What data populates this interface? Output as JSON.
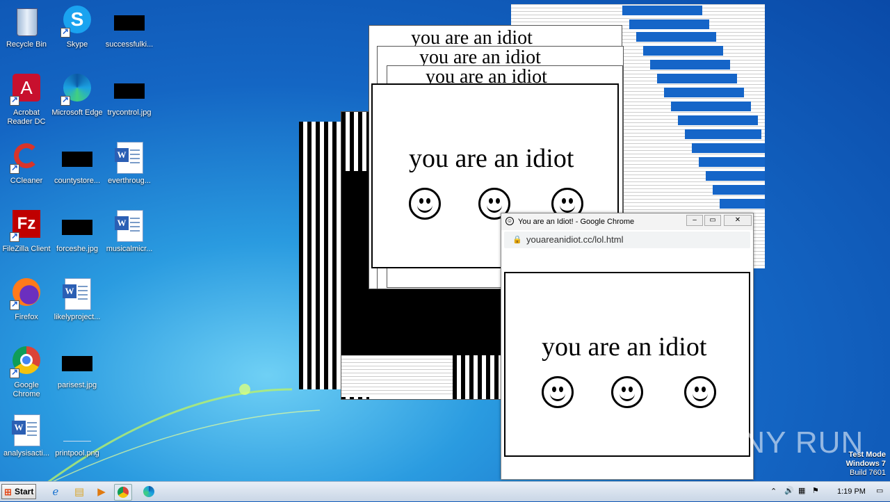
{
  "desktop": {
    "icons": [
      {
        "label": "Recycle Bin"
      },
      {
        "label": "Skype"
      },
      {
        "label": "successfulki..."
      },
      {
        "label": "Acrobat Reader DC"
      },
      {
        "label": "Microsoft Edge"
      },
      {
        "label": "trycontrol.jpg"
      },
      {
        "label": "CCleaner"
      },
      {
        "label": "countystore..."
      },
      {
        "label": "everthroug..."
      },
      {
        "label": "FileZilla Client"
      },
      {
        "label": "forceshe.jpg"
      },
      {
        "label": "musicalmicr..."
      },
      {
        "label": "Firefox"
      },
      {
        "label": "likelyproject..."
      },
      {
        "label": "Google Chrome"
      },
      {
        "label": "parisest.jpg"
      },
      {
        "label": "analysisacti..."
      },
      {
        "label": "printpool.png"
      }
    ]
  },
  "popup": {
    "title": "You are an Idiot! - Google Chrome",
    "url": "youareanidiot.cc/lol.html",
    "message": "you are an idiot",
    "btn_min": "‒",
    "btn_max": "▭",
    "btn_close": "✕"
  },
  "background_window": {
    "message": "you are an idiot",
    "title_fragment": "you are an idiot"
  },
  "taskbar": {
    "start_label": "Start",
    "clock": "1:19 PM"
  },
  "os_watermark": {
    "line1": "Test Mode",
    "line2": "Windows 7",
    "line3": "Build 7601"
  },
  "brand_watermark": "ANY RUN",
  "colors": {
    "accent_blue": "#1565c8",
    "taskbar": "#c9d6e6"
  }
}
